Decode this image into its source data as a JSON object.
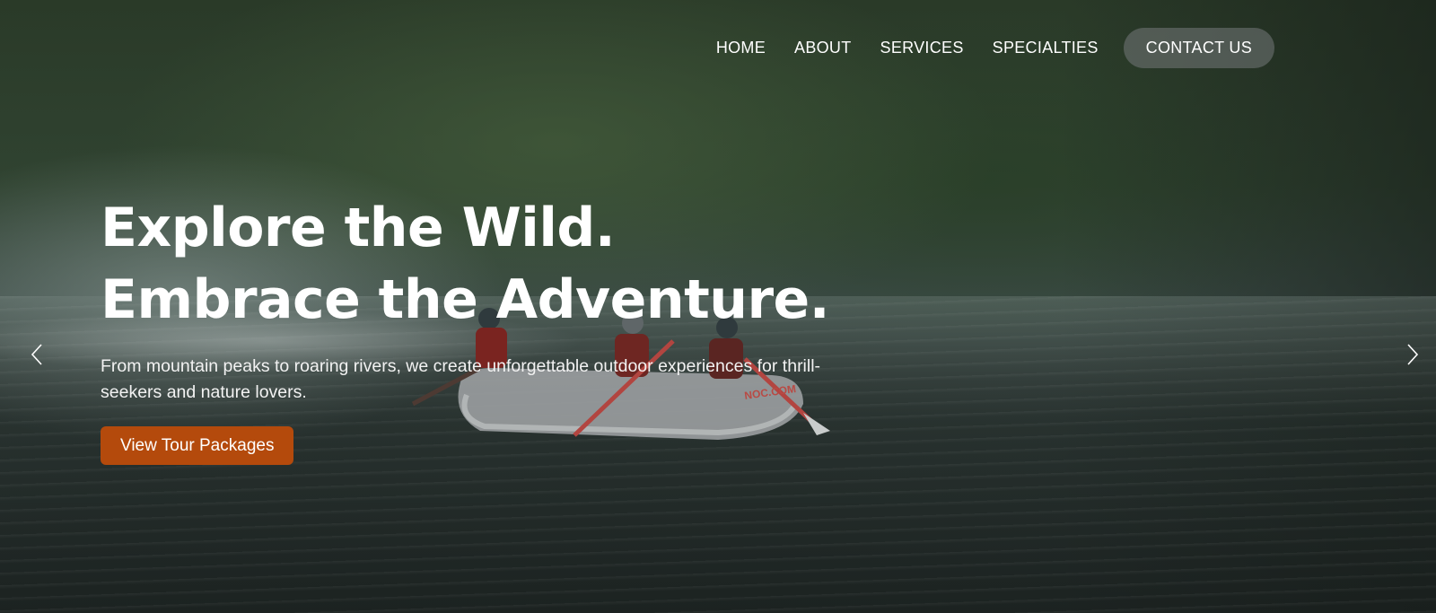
{
  "nav": {
    "items": [
      {
        "label": "HOME"
      },
      {
        "label": "ABOUT"
      },
      {
        "label": "SERVICES"
      },
      {
        "label": "SPECIALTIES"
      }
    ],
    "cta_label": "CONTACT US"
  },
  "hero": {
    "headline_line1": "Explore the Wild.",
    "headline_line2": "Embrace the Adventure.",
    "subtext": "From mountain peaks to roaring rivers, we create unforgettable outdoor experiences for thrill-seekers and nature lovers.",
    "button_label": "View Tour Packages",
    "background_image": "white-water-rafting-forest-river",
    "raft_lettering": "NOC.COM"
  },
  "carousel": {
    "prev_icon": "chevron-left-icon",
    "next_icon": "chevron-right-icon"
  },
  "colors": {
    "accent": "#b44a0c",
    "cta_bg": "rgba(110,115,115,0.6)",
    "text": "#ffffff"
  }
}
